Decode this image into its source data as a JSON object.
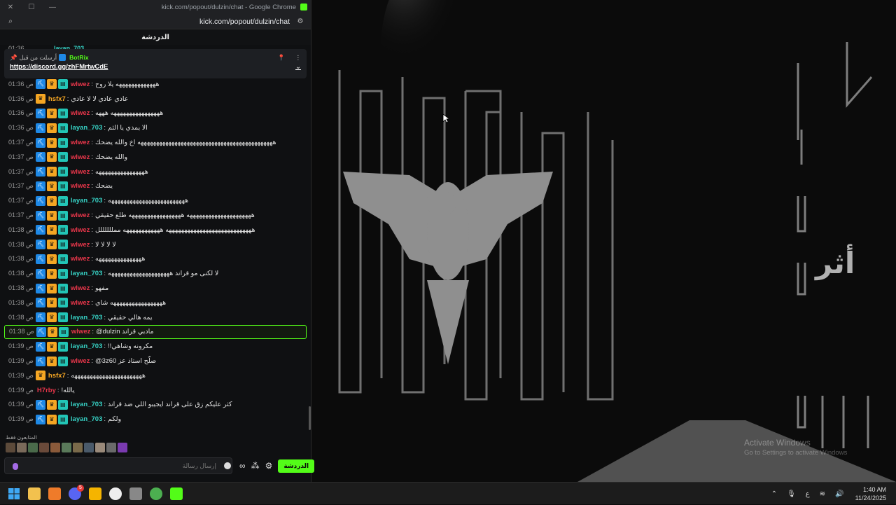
{
  "window": {
    "title": "kick.com/popout/dulzin/chat - Google Chrome",
    "url": "kick.com/popout/dulzin/chat",
    "chat_header": "الدردشة"
  },
  "pinned": {
    "pinned_by": "أرسلت من قبل",
    "user": "BotRix",
    "link": "https://discord.gg/zhFMrtwCdE",
    "partial_time": "01:36",
    "partial_user": "layan_703"
  },
  "messages": [
    {
      "time": "01:36 ص",
      "badges": [
        "blue",
        "gold",
        "teal"
      ],
      "user": "wlwez",
      "color": "#e8364a",
      "text": "هههههههههههههه يلا روح"
    },
    {
      "time": "01:36 ص",
      "badges": [
        "gold"
      ],
      "user": "hsfx7",
      "color": "#f5a623",
      "text": "عادي عادي لا لا عادي"
    },
    {
      "time": "01:36 ص",
      "badges": [
        "blue",
        "gold",
        "teal"
      ],
      "user": "wlwez",
      "color": "#e8364a",
      "text": "ههههههههههههههههه هههه"
    },
    {
      "time": "01:36 ص",
      "badges": [
        "blue",
        "gold",
        "teal"
      ],
      "user": "layan_703",
      "color": "#36d1c4",
      "text": "الا يمدي يا الثم"
    },
    {
      "time": "01:37 ص",
      "badges": [
        "blue",
        "gold",
        "teal"
      ],
      "user": "wlwez",
      "color": "#e8364a",
      "text": "ههههههههههههههههههههههههههههههههههههههههههههه اخ والله يضحك"
    },
    {
      "time": "01:37 ص",
      "badges": [
        "blue",
        "gold",
        "teal"
      ],
      "user": "wlwez",
      "color": "#e8364a",
      "text": "والله يضحك"
    },
    {
      "time": "01:37 ص",
      "badges": [
        "blue",
        "gold",
        "teal"
      ],
      "user": "wlwez",
      "color": "#e8364a",
      "text": "ههههههههههههههههه"
    },
    {
      "time": "01:37 ص",
      "badges": [
        "blue",
        "gold",
        "teal"
      ],
      "user": "wlwez",
      "color": "#e8364a",
      "text": "يضحك"
    },
    {
      "time": "01:37 ص",
      "badges": [
        "blue",
        "gold",
        "teal"
      ],
      "user": "layan_703",
      "color": "#36d1c4",
      "text": "هههههههههههههههههههههههههه"
    },
    {
      "time": "01:37 ص",
      "badges": [
        "blue",
        "gold",
        "teal"
      ],
      "user": "wlwez",
      "color": "#e8364a",
      "text": "هههههههههههههههههههههه هههههههههههههههههه طلع حقيقي"
    },
    {
      "time": "01:38 ص",
      "badges": [
        "blue",
        "gold",
        "teal"
      ],
      "user": "wlwez",
      "color": "#e8364a",
      "text": "ههههههههههههههههههههههههههههه ههههههههههههه ممللللللل"
    },
    {
      "time": "01:38 ص",
      "badges": [
        "blue",
        "gold",
        "teal"
      ],
      "user": "wlwez",
      "color": "#e8364a",
      "text": "لا لا لا لا"
    },
    {
      "time": "01:38 ص",
      "badges": [
        "blue",
        "gold",
        "teal"
      ],
      "user": "wlwez",
      "color": "#e8364a",
      "text": "هههههههههههههههه"
    },
    {
      "time": "01:38 ص",
      "badges": [
        "blue",
        "gold",
        "teal"
      ],
      "user": "layan_703",
      "color": "#36d1c4",
      "text": "لا لكنى مو قراند ههههههههههههههههههههه"
    },
    {
      "time": "01:38 ص",
      "badges": [
        "blue",
        "gold",
        "teal"
      ],
      "user": "wlwez",
      "color": "#e8364a",
      "text": "مفهو"
    },
    {
      "time": "01:38 ص",
      "badges": [
        "blue",
        "gold",
        "teal"
      ],
      "user": "wlwez",
      "color": "#e8364a",
      "text": "هههههههههههههههههه شاي"
    },
    {
      "time": "01:38 ص",
      "badges": [
        "blue",
        "gold",
        "teal"
      ],
      "user": "layan_703",
      "color": "#36d1c4",
      "text": "يمه هالي حقيقي"
    },
    {
      "time": "01:38 ص",
      "badges": [
        "blue",
        "gold",
        "teal"
      ],
      "user": "wlwez",
      "color": "#e8364a",
      "text": "@dulzin مادبي قراند",
      "highlight": true
    },
    {
      "time": "01:39 ص",
      "badges": [
        "blue",
        "gold",
        "teal"
      ],
      "user": "layan_703",
      "color": "#36d1c4",
      "text": "!!مكرونه وشاهي"
    },
    {
      "time": "01:39 ص",
      "badges": [
        "blue",
        "gold",
        "teal"
      ],
      "user": "wlwez",
      "color": "#e8364a",
      "text": "@3z60 صلّح استاذ عز"
    },
    {
      "time": "01:39 ص",
      "badges": [
        "gold"
      ],
      "user": "hsfx7",
      "color": "#f5a623",
      "text": "هههههههههههههههههههههههه"
    },
    {
      "time": "01:39 ص",
      "badges": [],
      "user": "H7rby",
      "color": "#e8364a",
      "text": "!يالله"
    },
    {
      "time": "01:39 ص",
      "badges": [
        "blue",
        "gold",
        "teal"
      ],
      "user": "layan_703",
      "color": "#36d1c4",
      "text": "كثر عليكم زق على قراند ايجيبو اللي ضد قراند"
    },
    {
      "time": "01:39 ص",
      "badges": [
        "blue",
        "gold",
        "teal"
      ],
      "user": "layan_703",
      "color": "#36d1c4",
      "text": "ولكم"
    }
  ],
  "emotes_label": "المتابعون فقط",
  "input": {
    "placeholder": "إرسال رسالة",
    "send_label": "الدردشة"
  },
  "desktop": {
    "watermark_title": "Activate Windows",
    "watermark_sub": "Go to Settings to activate Windows",
    "side_glyph": "أثر"
  },
  "taskbar": {
    "lang": "ع",
    "time": "1:40 AM",
    "date": "11/24/2025",
    "discord_badge": "5"
  },
  "colors": {
    "kick_green": "#53fc18"
  }
}
